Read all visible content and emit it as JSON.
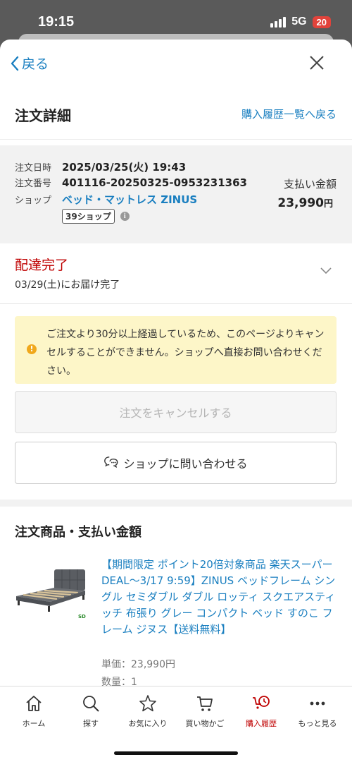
{
  "status_bar": {
    "time": "19:15",
    "network": "5G",
    "battery": "20"
  },
  "nav": {
    "back_label": "戻る"
  },
  "header": {
    "title": "注文詳細",
    "history_link": "購入履歴一覧へ戻る"
  },
  "order": {
    "date_label": "注文日時",
    "date_value": "2025/03/25(火) 19:43",
    "number_label": "注文番号",
    "number_value": "401116-20250325-0953231363",
    "shop_label": "ショップ",
    "shop_value": "ベッド・マットレス ZINUS",
    "badge": "39ショップ",
    "payment_label": "支払い金額",
    "payment_value": "23,990",
    "payment_unit": "円"
  },
  "delivery": {
    "status": "配達完了",
    "date": "03/29(土)にお届け完了"
  },
  "notice": {
    "text": "ご注文より30分以上経過しているため、このページよりキャンセルすることができません。ショップへ直接お問い合わせください。"
  },
  "buttons": {
    "cancel": "注文をキャンセルする",
    "contact": "ショップに問い合わせる"
  },
  "items": {
    "title": "注文商品・支払い金額",
    "product_name": "【期間限定 ポイント20倍対象商品 楽天スーパーDEAL～3/17 9:59】ZINUS ベッドフレーム シングル セミダブル ダブル ロッティ スクエアスティッチ 布張り グレー コンパクト ベッド すのこ フレーム ジヌス【送料無料】",
    "unit_price": "単価：23,990円",
    "quantity": "数量：1",
    "image_badge": "SD"
  },
  "tabbar": {
    "tabs": [
      {
        "label": "ホーム",
        "icon": "home-icon"
      },
      {
        "label": "探す",
        "icon": "search-icon"
      },
      {
        "label": "お気に入り",
        "icon": "star-icon"
      },
      {
        "label": "買い物かご",
        "icon": "cart-icon"
      },
      {
        "label": "購入履歴",
        "icon": "history-icon",
        "active": true
      },
      {
        "label": "もっと見る",
        "icon": "more-icon"
      }
    ]
  },
  "colors": {
    "link": "#1a7fc0",
    "accent_red": "#bf0000",
    "notice_bg": "#fdf6c8"
  }
}
